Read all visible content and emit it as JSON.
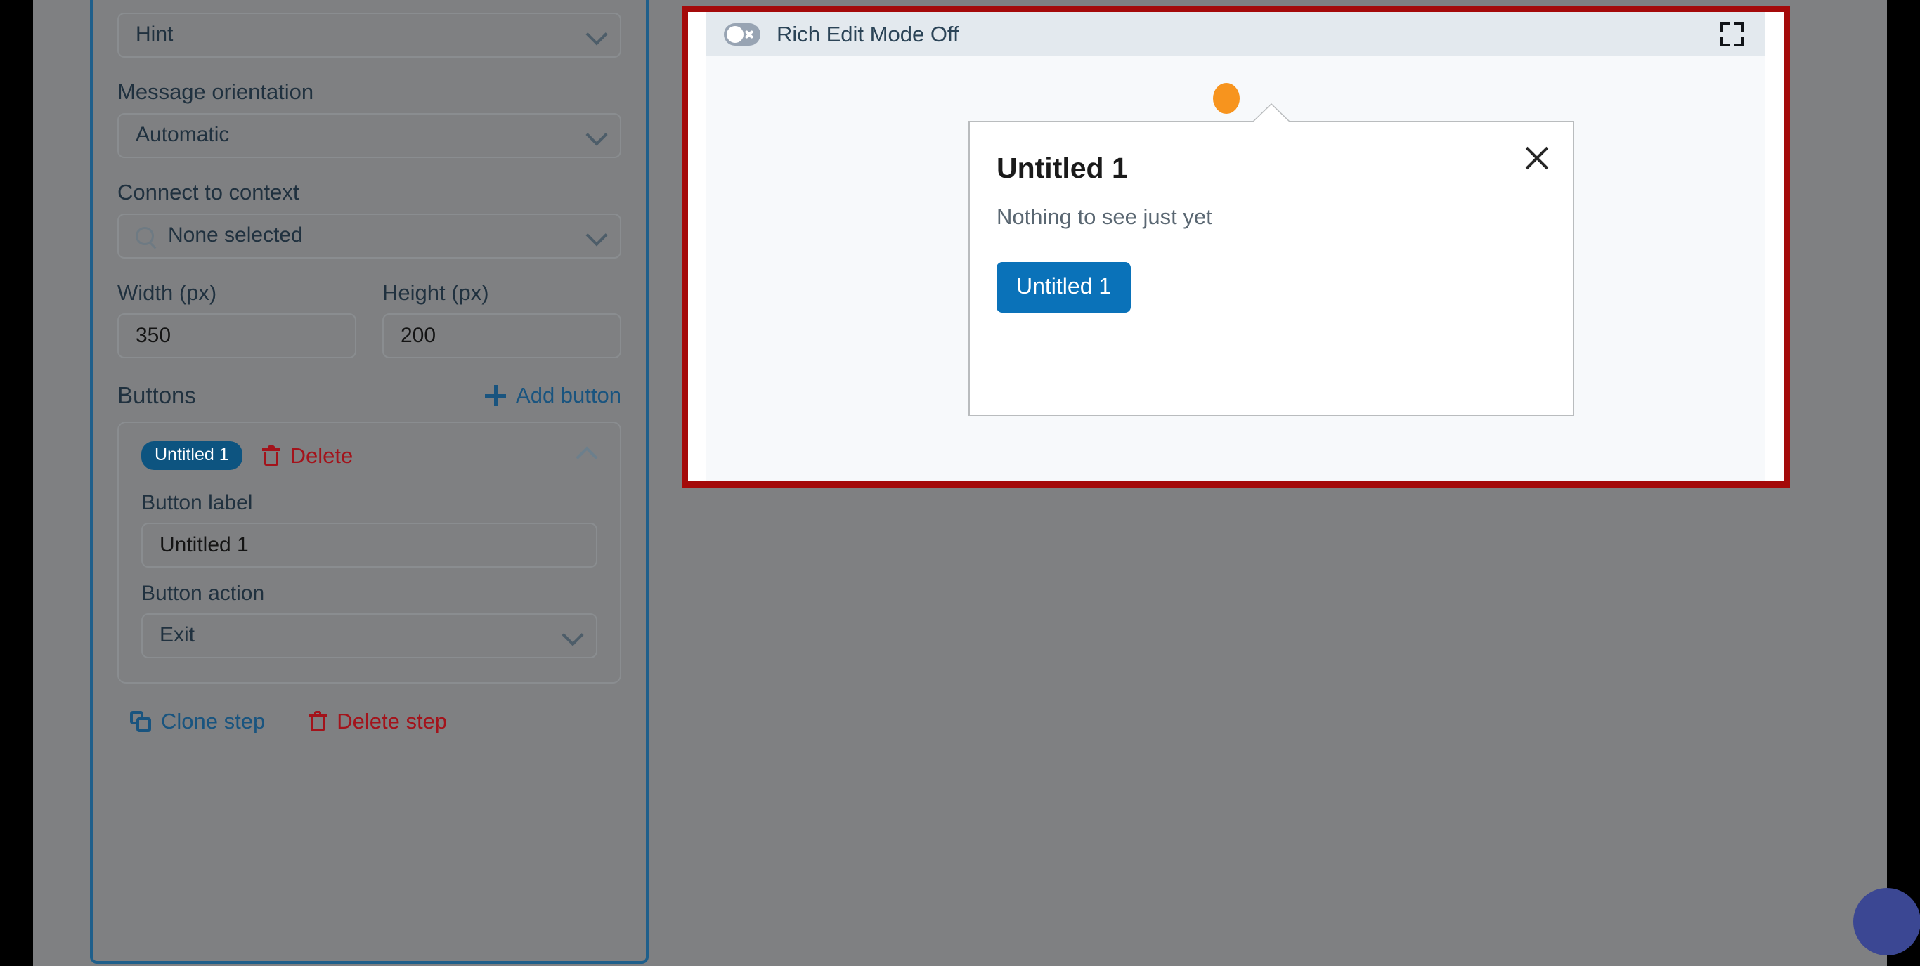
{
  "theme": {
    "accent_blue": "#19547f",
    "danger_red": "#a3131b",
    "highlight_red": "#a40a0a",
    "badge_blue": "#0d5480",
    "primary_button_blue": "#0a72b9",
    "marker_orange": "#f7941e",
    "panel_border_blue": "#1f5f8b",
    "fab_blue": "#3b4793"
  },
  "settings_panel": {
    "message_type": {
      "value": "Hint",
      "icon": "chevron-down-icon"
    },
    "message_orientation": {
      "label": "Message orientation",
      "value": "Automatic",
      "icon": "chevron-down-icon"
    },
    "connect_to_context": {
      "label": "Connect to context",
      "value": "None selected",
      "search_icon": "search-icon",
      "icon": "chevron-down-icon"
    },
    "width": {
      "label": "Width (px)",
      "value": "350"
    },
    "height": {
      "label": "Height (px)",
      "value": "200"
    },
    "buttons_section": {
      "title": "Buttons",
      "add_button_label": "Add button",
      "add_icon": "plus-icon",
      "button_card": {
        "badge": "Untitled 1",
        "delete_label": "Delete",
        "delete_icon": "trash-icon",
        "collapse_icon": "chevron-up-icon",
        "button_label_label": "Button label",
        "button_label_value": "Untitled 1",
        "button_action_label": "Button action",
        "button_action_value": "Exit",
        "button_action_icon": "chevron-down-icon"
      }
    },
    "step_actions": {
      "clone_label": "Clone step",
      "clone_icon": "copy-icon",
      "delete_label": "Delete step",
      "delete_icon": "trash-icon"
    }
  },
  "preview": {
    "header": {
      "toggle_state": "off",
      "toggle_icon": "toggle-off-icon",
      "title": "Rich Edit Mode Off",
      "expand_icon": "fullscreen-expand-icon"
    },
    "anchor_marker_icon": "orange-anchor-dot-icon",
    "dialog": {
      "title": "Untitled 1",
      "body_text": "Nothing to see just yet",
      "close_icon": "close-icon",
      "action_button_label": "Untitled 1"
    }
  },
  "help_fab": {
    "icon": "help-chat-fab-icon"
  }
}
